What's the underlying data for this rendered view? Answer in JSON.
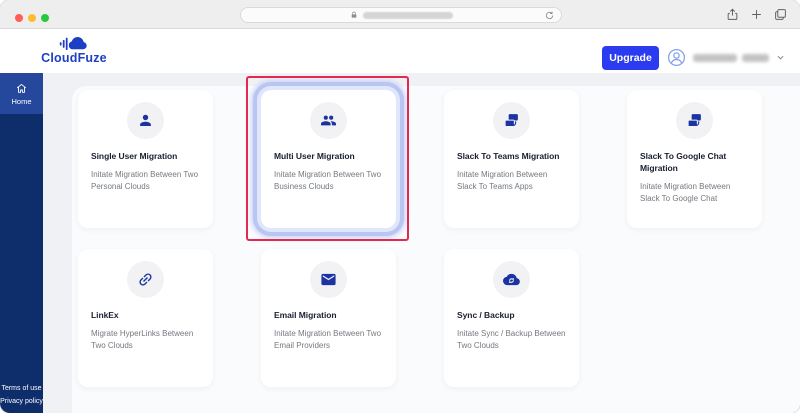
{
  "browser": {
    "traffic_lights": [
      {
        "icon": "close-button",
        "color": "#ff5f57"
      },
      {
        "icon": "minimize-button",
        "color": "#febc2e"
      },
      {
        "icon": "zoom-button",
        "color": "#28c840"
      }
    ],
    "address_bar": {
      "lock_icon": "lock-icon",
      "reload_icon": "reload-icon",
      "url_redacted": true
    },
    "toolbar_icons": [
      "share-icon",
      "plus-icon",
      "tabs-icon"
    ]
  },
  "header": {
    "brand": "CloudFuze",
    "logo_icon": "cloudfuze-logo-icon",
    "upgrade_label": "Upgrade",
    "user": {
      "avatar_icon": "user-avatar-icon",
      "chevron_icon": "chevron-down-icon",
      "name_redacted": true
    }
  },
  "sidebar": {
    "nav_items": [
      {
        "label": "Home",
        "icon": "home-icon",
        "active": true
      }
    ],
    "footer_links": [
      {
        "label": "Terms of use"
      },
      {
        "label": "Privacy policy"
      }
    ]
  },
  "main": {
    "cards": [
      {
        "title": "Single User Migration",
        "description": "Initate Migration Between Two Personal Clouds",
        "icon": "single-user-icon",
        "highlighted": false
      },
      {
        "title": "Multi User Migration",
        "description": "Initate Migration Between Two Business Clouds",
        "icon": "multi-user-icon",
        "highlighted": true
      },
      {
        "title": "Slack To Teams Migration",
        "description": "Initate Migration Between Slack To Teams Apps",
        "icon": "slack-teams-icon",
        "highlighted": false
      },
      {
        "title": "Slack To Google Chat Migration",
        "description": "Initate Migration Between Slack To Google Chat",
        "icon": "slack-gchat-icon",
        "highlighted": false
      },
      {
        "title": "LinkEx",
        "description": "Migrate HyperLinks Between Two Clouds",
        "icon": "link-icon",
        "highlighted": false
      },
      {
        "title": "Email Migration",
        "description": "Initate Migration Between Two Email Providers",
        "icon": "email-icon",
        "highlighted": false
      },
      {
        "title": "Sync / Backup",
        "description": "Initate Sync / Backup Between Two Clouds",
        "icon": "cloud-sync-icon",
        "highlighted": false
      }
    ]
  },
  "colors": {
    "accent_blue": "#2b3cf0",
    "brand_blue": "#1d3fc6",
    "card_icon_blue": "#1c33a2",
    "sidebar_navy": "#0e2d6b",
    "sidebar_active": "#26489c",
    "highlight_ring": "#bac6f2",
    "annotation_red": "#e62850"
  }
}
